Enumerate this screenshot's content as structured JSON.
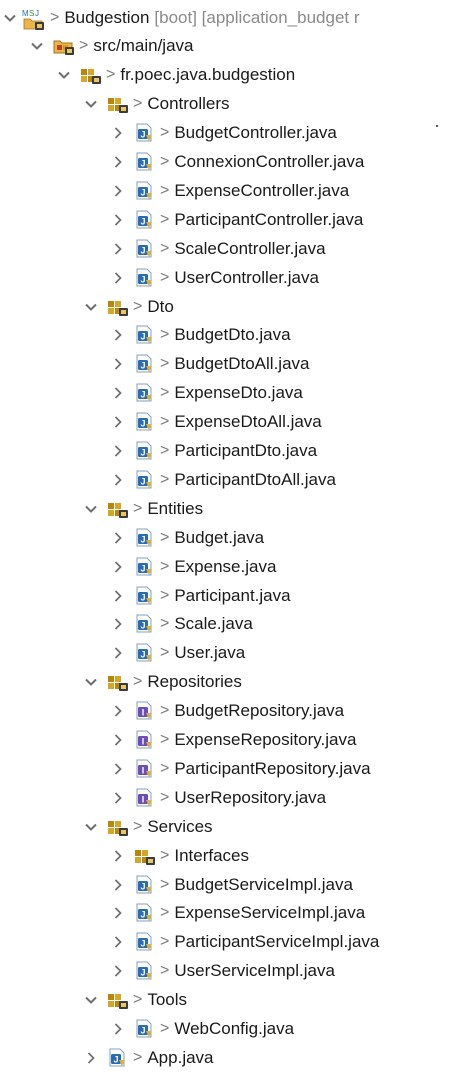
{
  "tree": [
    {
      "label": "Budgestion",
      "decoration": "[boot] [application_budget r",
      "type": "project",
      "level": 0,
      "expanded": true
    },
    {
      "label": "src/main/java",
      "type": "srcfolder",
      "level": 1,
      "expanded": true
    },
    {
      "label": "fr.poec.java.budgestion",
      "type": "package",
      "level": 2,
      "expanded": true
    },
    {
      "label": "Controllers",
      "type": "package",
      "level": 3,
      "expanded": true
    },
    {
      "label": "BudgetController.java",
      "type": "class",
      "level": 4,
      "expanded": false
    },
    {
      "label": "ConnexionController.java",
      "type": "class",
      "level": 4,
      "expanded": false
    },
    {
      "label": "ExpenseController.java",
      "type": "class",
      "level": 4,
      "expanded": false
    },
    {
      "label": "ParticipantController.java",
      "type": "class",
      "level": 4,
      "expanded": false
    },
    {
      "label": "ScaleController.java",
      "type": "class",
      "level": 4,
      "expanded": false
    },
    {
      "label": "UserController.java",
      "type": "class",
      "level": 4,
      "expanded": false
    },
    {
      "label": "Dto",
      "type": "package",
      "level": 3,
      "expanded": true
    },
    {
      "label": "BudgetDto.java",
      "type": "class",
      "level": 4,
      "expanded": false
    },
    {
      "label": "BudgetDtoAll.java",
      "type": "class",
      "level": 4,
      "expanded": false
    },
    {
      "label": "ExpenseDto.java",
      "type": "class",
      "level": 4,
      "expanded": false
    },
    {
      "label": "ExpenseDtoAll.java",
      "type": "class",
      "level": 4,
      "expanded": false
    },
    {
      "label": "ParticipantDto.java",
      "type": "class",
      "level": 4,
      "expanded": false
    },
    {
      "label": "ParticipantDtoAll.java",
      "type": "class",
      "level": 4,
      "expanded": false
    },
    {
      "label": "Entities",
      "type": "package",
      "level": 3,
      "expanded": true
    },
    {
      "label": "Budget.java",
      "type": "class",
      "level": 4,
      "expanded": false
    },
    {
      "label": "Expense.java",
      "type": "class",
      "level": 4,
      "expanded": false
    },
    {
      "label": "Participant.java",
      "type": "class",
      "level": 4,
      "expanded": false
    },
    {
      "label": "Scale.java",
      "type": "class",
      "level": 4,
      "expanded": false
    },
    {
      "label": "User.java",
      "type": "class",
      "level": 4,
      "expanded": false
    },
    {
      "label": "Repositories",
      "type": "package",
      "level": 3,
      "expanded": true
    },
    {
      "label": "BudgetRepository.java",
      "type": "interface",
      "level": 4,
      "expanded": false
    },
    {
      "label": "ExpenseRepository.java",
      "type": "interface",
      "level": 4,
      "expanded": false
    },
    {
      "label": "ParticipantRepository.java",
      "type": "interface",
      "level": 4,
      "expanded": false
    },
    {
      "label": "UserRepository.java",
      "type": "interface",
      "level": 4,
      "expanded": false
    },
    {
      "label": "Services",
      "type": "package",
      "level": 3,
      "expanded": true
    },
    {
      "label": "Interfaces",
      "type": "package",
      "level": 4,
      "expanded": false
    },
    {
      "label": "BudgetServiceImpl.java",
      "type": "class",
      "level": 4,
      "expanded": false
    },
    {
      "label": "ExpenseServiceImpl.java",
      "type": "class",
      "level": 4,
      "expanded": false
    },
    {
      "label": "ParticipantServiceImpl.java",
      "type": "class",
      "level": 4,
      "expanded": false
    },
    {
      "label": "UserServiceImpl.java",
      "type": "class",
      "level": 4,
      "expanded": false
    },
    {
      "label": "Tools",
      "type": "package",
      "level": 3,
      "expanded": true
    },
    {
      "label": "WebConfig.java",
      "type": "class",
      "level": 4,
      "expanded": false
    },
    {
      "label": "App.java",
      "type": "class",
      "level": 3,
      "expanded": false
    }
  ],
  "decorator_prefix": ">",
  "colors": {
    "label": "#1a1a1a",
    "decoration": "#8a8a8a",
    "twisty": "#6e6e6e",
    "package": "#b8860b",
    "java_file": "#2a6bb3",
    "project_label_accent": "#1f6fb2"
  }
}
